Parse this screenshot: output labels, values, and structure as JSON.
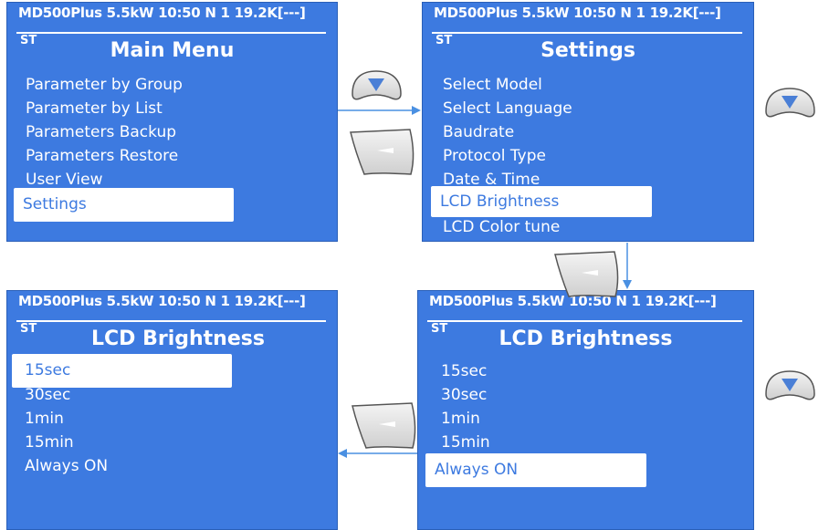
{
  "status_text": "MD500Plus  5.5kW  10:50  N  1 19.2K[---]",
  "mode_label": "ST",
  "screens": {
    "main_menu": {
      "title": "Main Menu",
      "items": [
        "Parameter by Group",
        "Parameter by List",
        "Parameters Backup",
        "Parameters Restore",
        "User View",
        "Settings"
      ]
    },
    "settings": {
      "title": "Settings",
      "items": [
        "Select Model",
        "Select Language",
        "Baudrate",
        "Protocol Type",
        "Date & Time",
        "LCD Brightness",
        "LCD Color tune"
      ]
    },
    "brightness_right": {
      "title": "LCD Brightness",
      "items": [
        "15sec",
        "30sec",
        "1min",
        "15min",
        "Always ON"
      ]
    },
    "brightness_left": {
      "title": "LCD Brightness",
      "items": [
        "15sec",
        "30sec",
        "1min",
        "15min",
        "Always ON"
      ]
    }
  },
  "colors": {
    "screen_bg": "#3d7ae0",
    "text": "#ffffff",
    "arrow": "#4a90e2",
    "key_fill": "#e6e6e6"
  },
  "icons": {
    "down_key": "down-arrow-key-icon",
    "confirm_key": "confirm-key-icon"
  }
}
